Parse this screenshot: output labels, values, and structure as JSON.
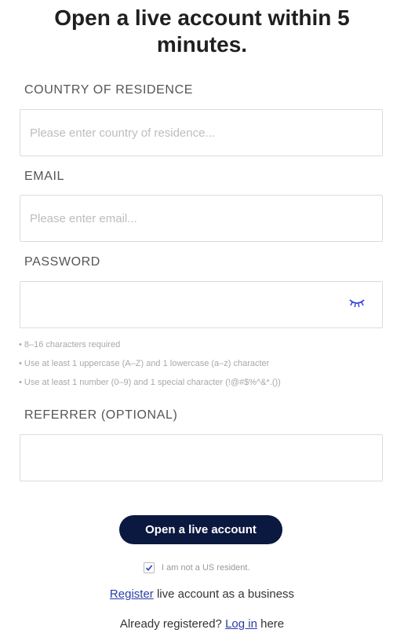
{
  "header": {
    "title": "Open a live account within 5 minutes."
  },
  "form": {
    "country": {
      "label": "COUNTRY OF RESIDENCE",
      "placeholder": "Please enter country of residence..."
    },
    "email": {
      "label": "EMAIL",
      "placeholder": "Please enter email..."
    },
    "password": {
      "label": "PASSWORD",
      "placeholder": "",
      "toggle_icon": "eye-closed-icon",
      "rules": [
        "• 8–16 characters required",
        "• Use at least 1 uppercase (A–Z) and 1 lowercase (a–z) character",
        "• Use at least 1 number (0–9) and 1 special character (!@#$%^&*.())"
      ]
    },
    "referrer": {
      "label": "REFERRER (OPTIONAL)",
      "placeholder": ""
    },
    "submit_label": "Open a live account",
    "us_resident": {
      "label": "I am not a US resident.",
      "checked": true
    }
  },
  "footer": {
    "register_link": "Register",
    "register_text": " live account as a business",
    "login_prefix": "Already registered? ",
    "login_link": "Log in",
    "login_suffix": " here"
  },
  "colors": {
    "button_bg": "#0b1840",
    "link": "#2a3ea8",
    "icon": "#2b3bd6"
  }
}
